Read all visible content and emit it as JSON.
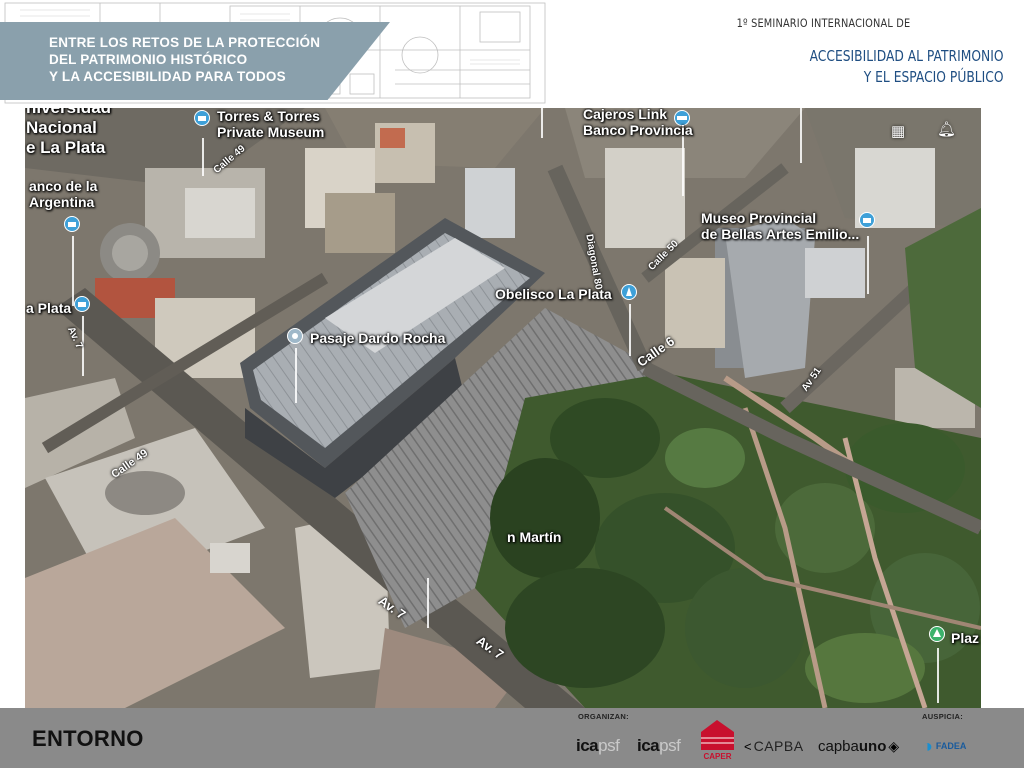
{
  "header": {
    "banner_lines": [
      "ENTRE LOS RETOS DE LA PROTECCIÓN",
      "DEL PATRIMONIO HISTÓRICO",
      "Y LA ACCESIBILIDAD PARA TODOS"
    ],
    "seminar_line": "1º SEMINARIO INTERNACIONAL DE",
    "title_lines": [
      "ACCESIBILIDAD AL PATRIMONIO",
      "Y EL ESPACIO PÚBLICO"
    ]
  },
  "map": {
    "places": {
      "universidad": [
        "niversidad",
        "Nacional",
        "e La Plata"
      ],
      "torres_museum": [
        "Torres & Torres",
        "Private Museum"
      ],
      "cajeros": [
        "Cajeros Link",
        "Banco Provincia"
      ],
      "banco_argentina": [
        "anco de la",
        "Argentina"
      ],
      "museo_bellas_artes": [
        "Museo Provincial",
        "de Bellas Artes Emilio..."
      ],
      "la_plata": "a Plata",
      "obelisco": "Obelisco La Plata",
      "pasaje": "Pasaje Dardo Rocha",
      "san_martin": "n Martín",
      "plaza": "Plaz"
    },
    "streets": {
      "calle49": "Calle 49",
      "calle49b": "Calle 49",
      "diagonal80": "Diagonal 80",
      "calle50": "Calle 50",
      "calle6": "Calle 6",
      "av7_a": "Av. 7",
      "av7_b": "Av. 7",
      "av7_c": "Av. 7",
      "av51": "Av 51"
    }
  },
  "footer": {
    "section_title": "ENTORNO",
    "organizan_label": "ORGANIZAN:",
    "auspicia_label": "AUSPICIA:",
    "logos": {
      "ica1_main": "ica",
      "ica1_tail": "psf",
      "ica2_main": "ica",
      "ica2_tail": "psf",
      "caper": "CAPER",
      "capba": "CAPBA",
      "capbauno_a": "capba",
      "capbauno_b": "uno",
      "fadea": "FADEA"
    }
  },
  "colors": {
    "banner": "#8aa0ac",
    "title_blue": "#1f4e82",
    "footer_gray": "#8a8a8a",
    "pin_blue": "#3ea0d8",
    "pin_green": "#3bb26b",
    "caper_red": "#c8102e"
  }
}
